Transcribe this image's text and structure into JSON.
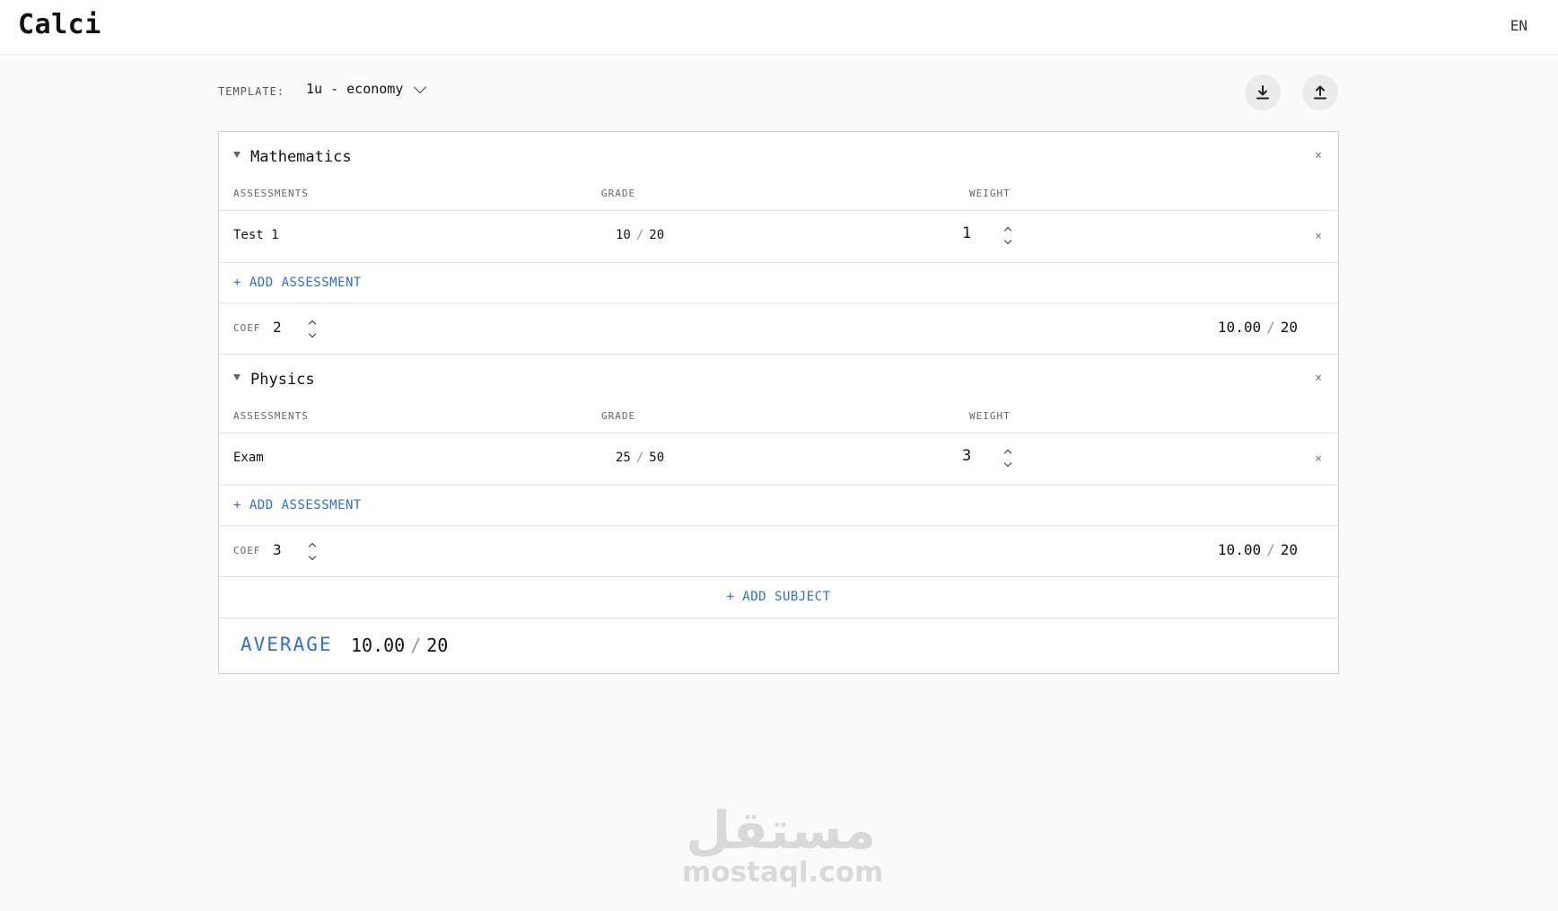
{
  "app": {
    "brand": "Calci",
    "language": "EN"
  },
  "template": {
    "label": "TEMPLATE:",
    "selected": "1u - economy"
  },
  "columns": {
    "assessments": "ASSESSMENTS",
    "grade": "GRADE",
    "weight": "WEIGHT"
  },
  "subjects": [
    {
      "name": "Mathematics",
      "assessments": [
        {
          "name": "Test 1",
          "score": "10",
          "max": "20",
          "weight": "1"
        }
      ],
      "add_label": "+ ADD ASSESSMENT",
      "coef_label": "COEF",
      "coef": "2",
      "total": "10.00",
      "total_max": "20"
    },
    {
      "name": "Physics",
      "assessments": [
        {
          "name": "Exam",
          "score": "25",
          "max": "50",
          "weight": "3"
        }
      ],
      "add_label": "+ ADD ASSESSMENT",
      "coef_label": "COEF",
      "coef": "3",
      "total": "10.00",
      "total_max": "20"
    }
  ],
  "add_subject_label": "+ ADD SUBJECT",
  "average": {
    "label": "AVERAGE",
    "value": "10.00",
    "max": "20"
  },
  "close_glyph": "×",
  "slash": "/",
  "watermark": {
    "arabic": "مستقل",
    "latin": "mostaql.com"
  },
  "colors": {
    "accent": "#2d6fd6",
    "border": "#cfcfcf",
    "button_bg": "#ebebec"
  }
}
